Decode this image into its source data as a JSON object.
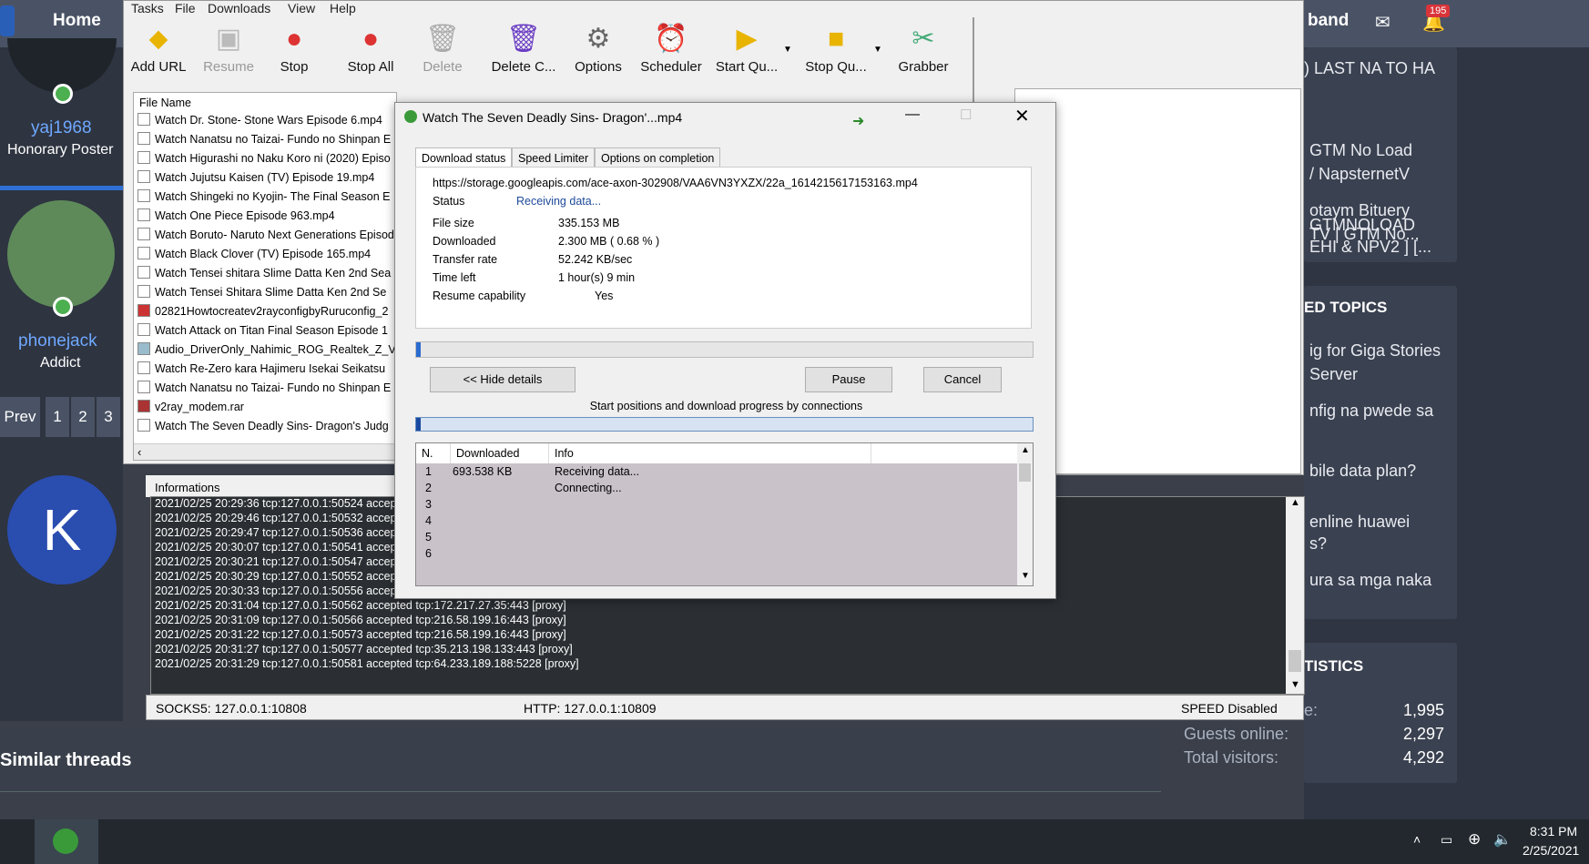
{
  "forum": {
    "nav_home": "Home",
    "brand_partial": "band",
    "notif_count": "195",
    "user1_name": "yaj1968",
    "user1_role": "Honorary Poster",
    "user2_name": "phonejack",
    "user2_role": "Addict",
    "avatar_letter": "K",
    "pagination": [
      "Prev",
      "1",
      "2",
      "3"
    ],
    "similar_threads": "Similar threads",
    "right_threads": [
      "LAST NA TO HA",
      "GTM No Load",
      "/ NapsternetV",
      "otaym Bituery",
      "TV | GTM No...",
      "GTMNOLOAD",
      "EHI & NPV2 ] [..."
    ],
    "right_threads_prefix": ") LAST NA TO HA",
    "topics_header": "ED TOPICS",
    "topics": [
      "ig for Giga Stories",
      "Server",
      "nfig na pwede sa",
      "bile data plan?",
      "enline huawei",
      "s?",
      "ura sa mga naka"
    ],
    "stats_header": "TISTICS",
    "stats": [
      {
        "label": "e:",
        "value": "1,995"
      },
      {
        "label": "Guests online:",
        "value": "2,297"
      },
      {
        "label": "Total visitors:",
        "value": "4,292"
      }
    ]
  },
  "idm": {
    "menu": [
      "Tasks",
      "File",
      "Downloads",
      "View",
      "Help"
    ],
    "toolbar": [
      {
        "label": "Add URL",
        "icon": "add-url-icon",
        "enabled": true
      },
      {
        "label": "Resume",
        "icon": "resume-icon",
        "enabled": false
      },
      {
        "label": "Stop",
        "icon": "stop-icon",
        "enabled": true
      },
      {
        "label": "Stop All",
        "icon": "stop-all-icon",
        "enabled": true
      },
      {
        "label": "Delete",
        "icon": "delete-icon",
        "enabled": false
      },
      {
        "label": "Delete C...",
        "icon": "delete-completed-icon",
        "enabled": true
      },
      {
        "label": "Options",
        "icon": "options-icon",
        "enabled": true
      },
      {
        "label": "Scheduler",
        "icon": "scheduler-icon",
        "enabled": true
      },
      {
        "label": "Start Qu...",
        "icon": "start-queue-icon",
        "enabled": true
      },
      {
        "label": "Stop Qu...",
        "icon": "stop-queue-icon",
        "enabled": true
      },
      {
        "label": "Grabber",
        "icon": "grabber-icon",
        "enabled": true
      }
    ],
    "file_header": "File Name",
    "files": [
      "Watch Dr. Stone- Stone Wars Episode 6.mp4",
      "Watch Nanatsu no Taizai- Fundo no Shinpan E",
      "Watch Higurashi no Naku Koro ni (2020) Episo",
      "Watch Jujutsu Kaisen (TV) Episode 19.mp4",
      "Watch Shingeki no Kyojin- The Final Season E",
      "Watch One Piece Episode 963.mp4",
      "Watch Boruto- Naruto Next Generations Episod",
      "Watch Black Clover (TV) Episode 165.mp4",
      "Watch Tensei shitara Slime Datta Ken 2nd Sea",
      "Watch Tensei Shitara Slime Datta Ken 2nd Se",
      "02821Howtocreatev2rayconfigbyRuruconfig_2",
      "Watch Attack on Titan Final Season Episode 1",
      "Audio_DriverOnly_Nahimic_ROG_Realtek_Z_V",
      "Watch Re-Zero kara Hajimeru Isekai Seikatsu",
      "Watch Nanatsu no Taizai- Fundo no Shinpan E",
      "v2ray_modem.rar",
      "Watch The Seven Deadly Sins- Dragon's Judg"
    ]
  },
  "log": {
    "title": "Informations",
    "lines": [
      "2021/02/25 20:29:36 tcp:127.0.0.1:50524 accep",
      "2021/02/25 20:29:46 tcp:127.0.0.1:50532 accep",
      "2021/02/25 20:29:47 tcp:127.0.0.1:50536 accep",
      "2021/02/25 20:30:07 tcp:127.0.0.1:50541 accep",
      "2021/02/25 20:30:21 tcp:127.0.0.1:50547 accep",
      "2021/02/25 20:30:29 tcp:127.0.0.1:50552 accep",
      "2021/02/25 20:30:33 tcp:127.0.0.1:50556 accep",
      "2021/02/25 20:31:04 tcp:127.0.0.1:50562 accepted tcp:172.217.27.35:443 [proxy]",
      "2021/02/25 20:31:09 tcp:127.0.0.1:50566 accepted tcp:216.58.199.16:443 [proxy]",
      "2021/02/25 20:31:22 tcp:127.0.0.1:50573 accepted tcp:216.58.199.16:443 [proxy]",
      "2021/02/25 20:31:27 tcp:127.0.0.1:50577 accepted tcp:35.213.198.133:443 [proxy]",
      "2021/02/25 20:31:29 tcp:127.0.0.1:50581 accepted tcp:64.233.189.188:5228 [proxy]"
    ],
    "socks": "SOCKS5:  127.0.0.1:10808",
    "http": "HTTP:  127.0.0.1:10809",
    "speed": "SPEED Disabled"
  },
  "dialog": {
    "title": "Watch The Seven Deadly Sins- Dragon'...mp4",
    "tabs": [
      "Download status",
      "Speed Limiter",
      "Options on completion"
    ],
    "url": "https://storage.googleapis.com/ace-axon-302908/VAA6VN3YXZX/22a_1614215617153163.mp4",
    "status_label": "Status",
    "status_value": "Receiving data...",
    "fields": [
      {
        "label": "File size",
        "value": "335.153  MB"
      },
      {
        "label": "Downloaded",
        "value": "2.300  MB  ( 0.68 % )"
      },
      {
        "label": "Transfer rate",
        "value": "52.242  KB/sec"
      },
      {
        "label": "Time left",
        "value": "1 hour(s) 9 min"
      }
    ],
    "resume_label": "Resume capability",
    "resume_value": "Yes",
    "progress": 0.0068,
    "hide_details": "<< Hide details",
    "pause": "Pause",
    "cancel": "Cancel",
    "connections_caption": "Start positions and download progress by connections",
    "table_headers": [
      "N.",
      "Downloaded",
      "Info"
    ],
    "connections": [
      {
        "n": "1",
        "downloaded": "693.538  KB",
        "info": "Receiving data..."
      },
      {
        "n": "2",
        "downloaded": "",
        "info": "Connecting..."
      },
      {
        "n": "3",
        "downloaded": "",
        "info": ""
      },
      {
        "n": "4",
        "downloaded": "",
        "info": ""
      },
      {
        "n": "5",
        "downloaded": "",
        "info": ""
      },
      {
        "n": "6",
        "downloaded": "",
        "info": ""
      }
    ]
  },
  "taskbar": {
    "time": "8:31 PM",
    "date": "2/25/2021"
  }
}
